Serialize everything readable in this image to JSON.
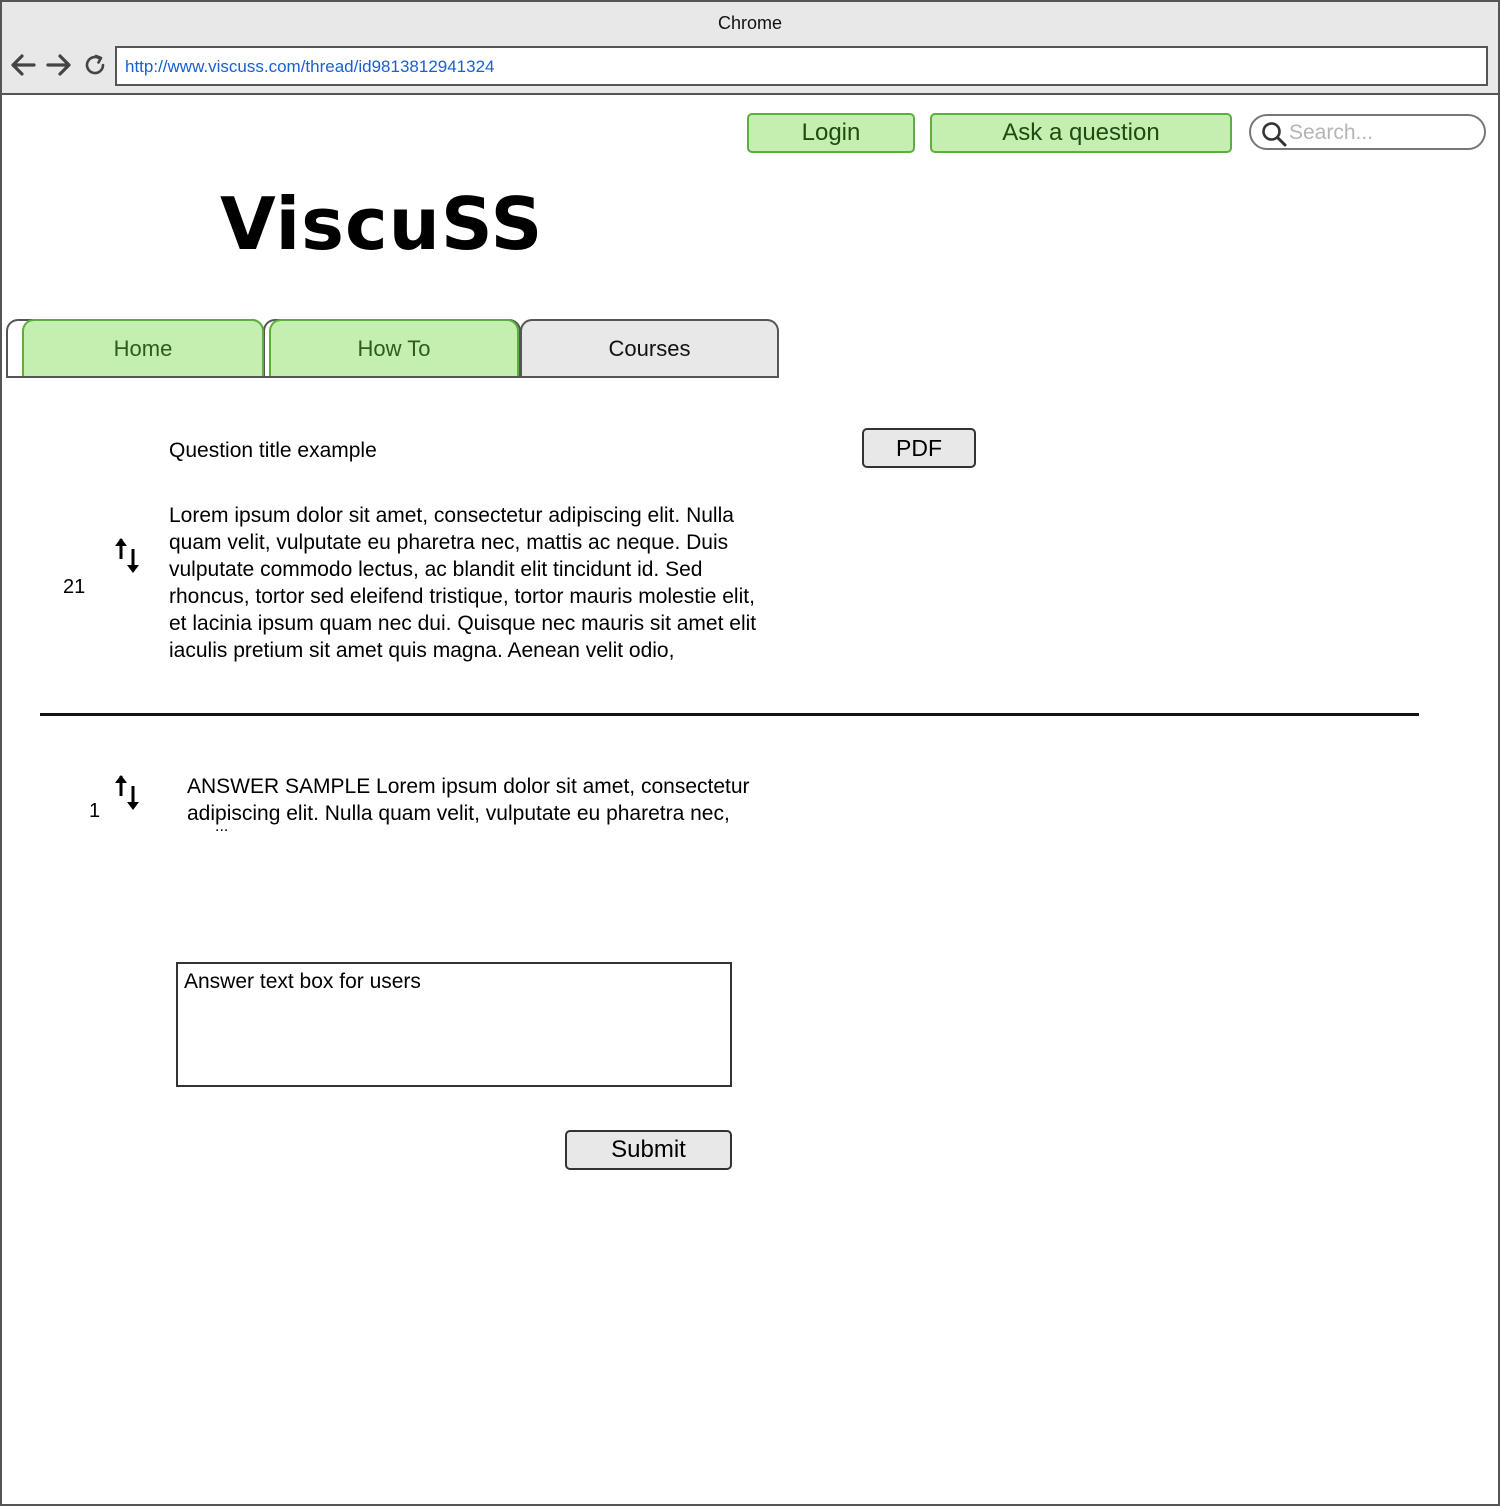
{
  "browser": {
    "title": "Chrome",
    "url": "http://www.viscuss.com/thread/id9813812941324"
  },
  "header": {
    "login_label": "Login",
    "ask_label": "Ask a question",
    "search_placeholder": "Search...",
    "logo": "ViscuSS"
  },
  "tabs": [
    {
      "label": "Home",
      "state": "highlighted"
    },
    {
      "label": "How To",
      "state": "highlighted"
    },
    {
      "label": "Courses",
      "state": "normal"
    }
  ],
  "question": {
    "title": "Question title example",
    "pdf_label": "PDF",
    "votes": "21",
    "body": "Lorem ipsum dolor sit amet, consectetur adipiscing elit. Nulla quam velit, vulputate eu pharetra nec, mattis ac neque. Duis vulputate commodo lectus, ac blandit elit tincidunt id. Sed rhoncus, tortor sed eleifend tristique, tortor mauris molestie elit, et lacinia ipsum quam nec dui. Quisque nec mauris sit amet elit iaculis pretium sit amet quis magna. Aenean velit odio,"
  },
  "answer": {
    "votes": "1",
    "body": "ANSWER SAMPLE Lorem ipsum dolor sit amet, consectetur adipiscing elit. Nulla quam velit, vulputate eu pharetra nec,",
    "ellipsis": "..."
  },
  "reply": {
    "placeholder": "Answer text box for users",
    "submit_label": "Submit"
  },
  "colors": {
    "highlight_fill": "#c5efb1",
    "highlight_border": "#5cae3f",
    "url_text": "#1a5fd1"
  }
}
